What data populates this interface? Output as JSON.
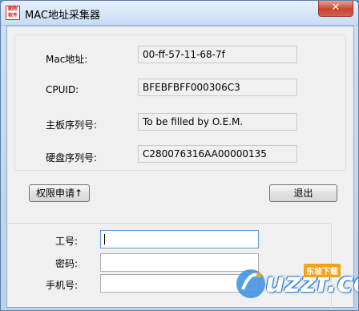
{
  "window": {
    "title": "MAC地址采集器",
    "close_glyph": "✕",
    "app_icon_text": [
      "朝晖",
      "软件"
    ]
  },
  "info": {
    "mac_label": "Mac地址:",
    "mac_value": "00-ff-57-11-68-7f",
    "cpuid_label": "CPUID:",
    "cpuid_value": "BFEBFBFF000306C3",
    "board_label": "主板序列号:",
    "board_value": "To be filled by O.E.M.",
    "disk_label": "硬盘序列号:",
    "disk_value": "C280076316AA00000135"
  },
  "actions": {
    "request_label": "权限申请↑",
    "exit_label": "退出"
  },
  "form": {
    "employee_id_label": "工号:",
    "employee_id_value": "",
    "password_label": "密码:",
    "password_value": "",
    "phone_label": "手机号:",
    "phone_value": ""
  },
  "watermark": {
    "text": "uzzf.com",
    "badge": "东坡下载"
  }
}
